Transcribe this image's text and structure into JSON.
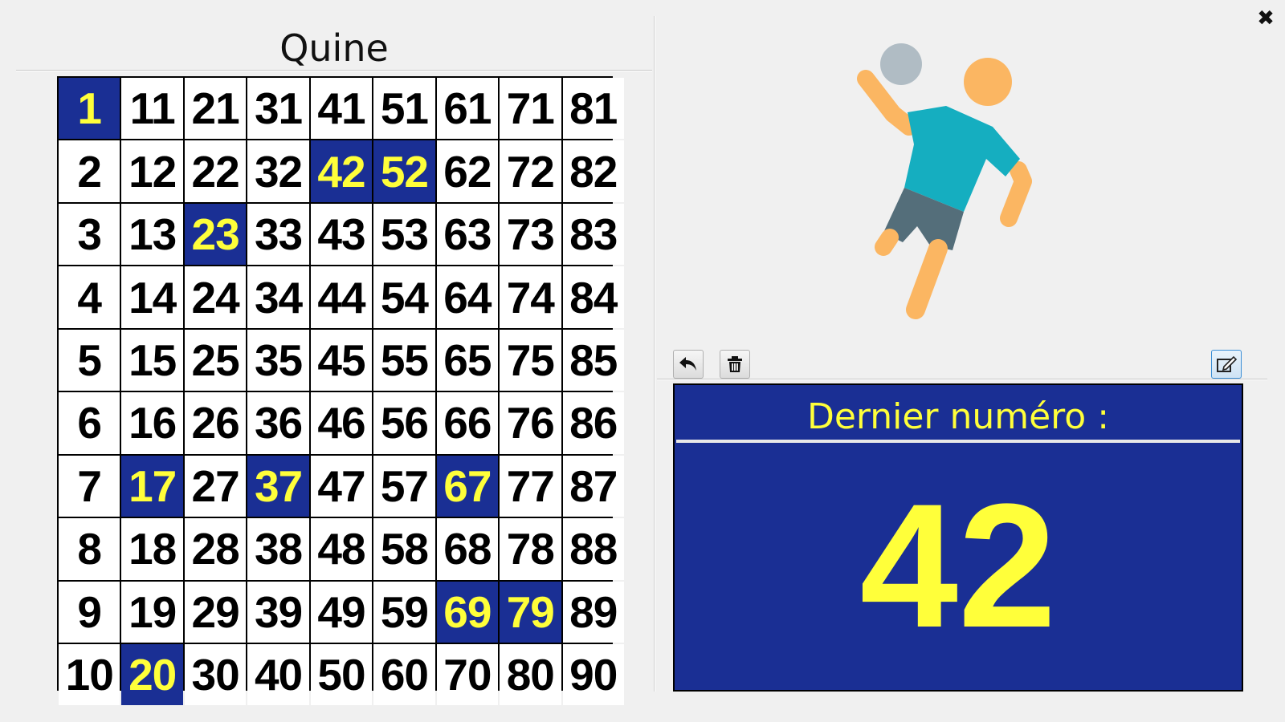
{
  "board": {
    "title": "Quine",
    "columns": [
      [
        "1",
        "2",
        "3",
        "4",
        "5",
        "6",
        "7",
        "8",
        "9",
        "10"
      ],
      [
        "11",
        "12",
        "13",
        "14",
        "15",
        "16",
        "17",
        "18",
        "19",
        "20"
      ],
      [
        "21",
        "22",
        "23",
        "24",
        "25",
        "26",
        "27",
        "28",
        "29",
        "30"
      ],
      [
        "31",
        "32",
        "33",
        "34",
        "35",
        "36",
        "37",
        "38",
        "39",
        "40"
      ],
      [
        "41",
        "42",
        "43",
        "44",
        "45",
        "46",
        "47",
        "48",
        "49",
        "50"
      ],
      [
        "51",
        "52",
        "53",
        "54",
        "55",
        "56",
        "57",
        "58",
        "59",
        "60"
      ],
      [
        "61",
        "62",
        "63",
        "64",
        "65",
        "66",
        "67",
        "68",
        "69",
        "70"
      ],
      [
        "71",
        "72",
        "73",
        "74",
        "75",
        "76",
        "77",
        "78",
        "79",
        "80"
      ],
      [
        "81",
        "82",
        "83",
        "84",
        "85",
        "86",
        "87",
        "88",
        "89",
        "90"
      ]
    ],
    "drawn_numbers": [
      "1",
      "17",
      "20",
      "23",
      "37",
      "42",
      "52",
      "67",
      "69",
      "79"
    ]
  },
  "toolbar": {
    "undo_icon": "undo-icon",
    "delete_icon": "trash-icon",
    "edit_icon": "edit-icon",
    "close_icon": "close-icon",
    "close_glyph": "✖"
  },
  "last_draw": {
    "label": "Dernier numéro :",
    "number": "42"
  },
  "colors": {
    "drawn_bg": "#1a2f94",
    "drawn_fg": "#ffff3a",
    "panel_bg": "#1a2f94",
    "accent_text": "#ffff3a"
  },
  "illustration": {
    "icon": "handball-player-icon"
  }
}
